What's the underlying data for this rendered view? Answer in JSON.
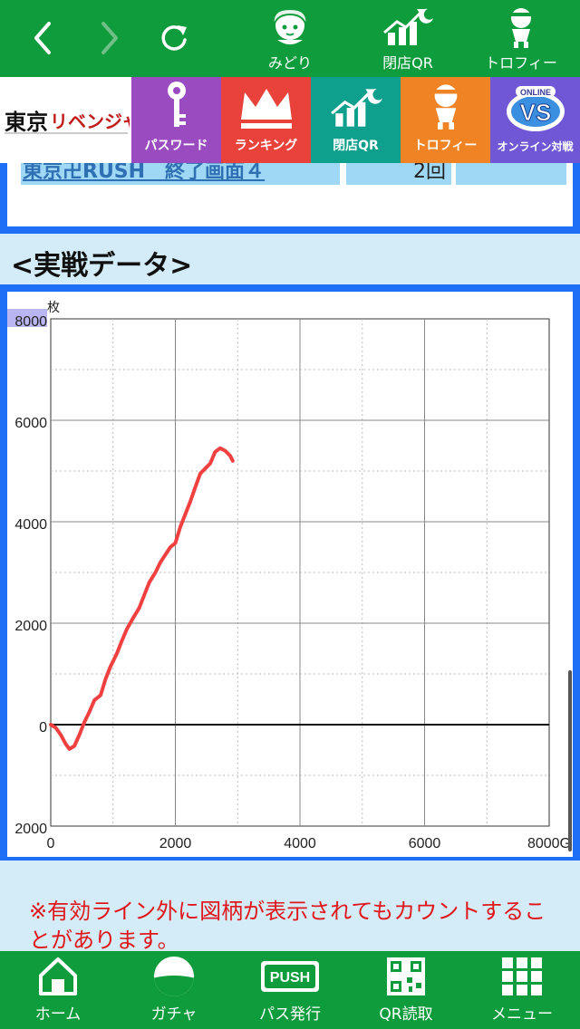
{
  "topbar": {
    "items": [
      {
        "label": "みどり"
      },
      {
        "label": "閉店QR"
      },
      {
        "label": "トロフィー"
      }
    ]
  },
  "menu": {
    "logo_text": "東京リベンジャーズ",
    "tiles": [
      {
        "label": "パスワード",
        "color": "#9b4bc0"
      },
      {
        "label": "ランキング",
        "color": "#e8423b"
      },
      {
        "label": "閉店QR",
        "color": "#0ea08c"
      },
      {
        "label": "トロフィー",
        "color": "#f08324"
      },
      {
        "label": "オンライン対戦",
        "color": "#6f57d6"
      }
    ],
    "vs_badge": "VS",
    "vs_small": "ONLINE"
  },
  "table_row": {
    "name": "東京卍RUSH　終了画面４",
    "count": "2回",
    "extra": ""
  },
  "section": {
    "title": "<実戦データ>"
  },
  "chart_data": {
    "type": "line",
    "y_unit_label": "枚",
    "x_unit_suffix": "G",
    "y_ticks": [
      "8000",
      "6000",
      "4000",
      "2000",
      "0",
      "2000"
    ],
    "x_ticks": [
      "0",
      "2000",
      "4000",
      "6000",
      "8000G"
    ],
    "xlim": [
      0,
      8000
    ],
    "ylim": [
      -2000,
      8000
    ],
    "grid": true,
    "series": [
      {
        "color": "#f04040",
        "points": [
          [
            0,
            0
          ],
          [
            80,
            -60
          ],
          [
            160,
            -200
          ],
          [
            240,
            -380
          ],
          [
            300,
            -480
          ],
          [
            380,
            -420
          ],
          [
            460,
            -200
          ],
          [
            540,
            50
          ],
          [
            620,
            250
          ],
          [
            700,
            480
          ],
          [
            800,
            580
          ],
          [
            880,
            900
          ],
          [
            960,
            1150
          ],
          [
            1060,
            1400
          ],
          [
            1140,
            1650
          ],
          [
            1220,
            1880
          ],
          [
            1320,
            2100
          ],
          [
            1420,
            2300
          ],
          [
            1500,
            2550
          ],
          [
            1580,
            2800
          ],
          [
            1680,
            3000
          ],
          [
            1760,
            3200
          ],
          [
            1840,
            3350
          ],
          [
            1920,
            3500
          ],
          [
            2000,
            3580
          ],
          [
            2080,
            3900
          ],
          [
            2160,
            4150
          ],
          [
            2240,
            4400
          ],
          [
            2320,
            4680
          ],
          [
            2400,
            4950
          ],
          [
            2480,
            5050
          ],
          [
            2560,
            5150
          ],
          [
            2640,
            5380
          ],
          [
            2720,
            5450
          ],
          [
            2800,
            5400
          ],
          [
            2880,
            5300
          ],
          [
            2920,
            5200
          ]
        ]
      }
    ]
  },
  "notice": {
    "text": "※有効ライン外に図柄が表示されてもカウントすることがあります。"
  },
  "bottomnav": {
    "items": [
      {
        "label": "ホーム"
      },
      {
        "label": "ガチャ"
      },
      {
        "label": "パス発行"
      },
      {
        "label": "QR読取"
      },
      {
        "label": "メニュー"
      }
    ],
    "push_label": "PUSH"
  },
  "colors": {
    "green": "#0f9c3c",
    "panel_blue": "#1e6ff5",
    "bg": "#d3ecf8",
    "notice_red": "#e0161b"
  }
}
